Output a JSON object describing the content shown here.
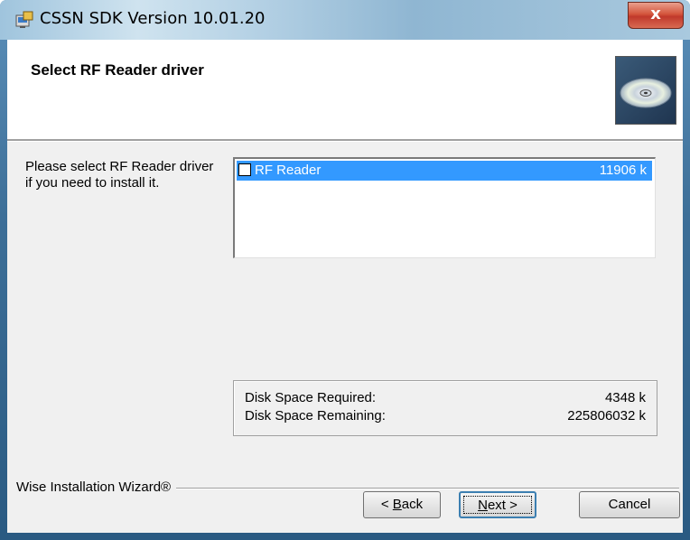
{
  "window": {
    "title": "CSSN SDK Version 10.01.20",
    "close_label": "x"
  },
  "header": {
    "title": "Select RF Reader driver"
  },
  "instructions": "Please select RF Reader driver if you need to install it.",
  "components": [
    {
      "label": "RF Reader",
      "size": "11906 k",
      "checked": false,
      "selected": true
    }
  ],
  "disk_space": {
    "required_label": "Disk Space Required:",
    "required_value": "4348 k",
    "remaining_label": "Disk Space Remaining:",
    "remaining_value": "225806032 k"
  },
  "footer": {
    "brand": "Wise Installation Wizard®",
    "back_prefix": "< ",
    "back_hotkey": "B",
    "back_rest": "ack",
    "next_hotkey": "N",
    "next_rest": "ext >",
    "cancel": "Cancel"
  },
  "colors": {
    "selection": "#3399ff",
    "dialog_bg": "#f0f0f0",
    "close_button": "#c0392b"
  }
}
